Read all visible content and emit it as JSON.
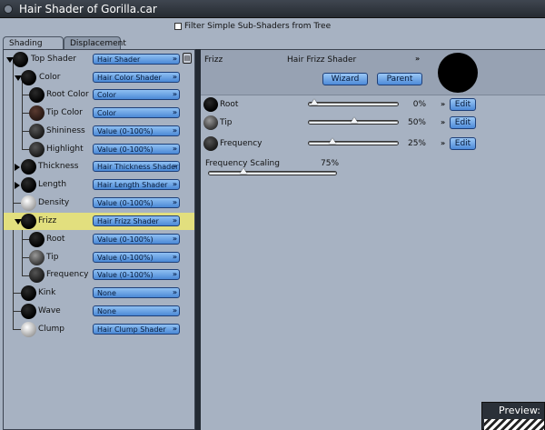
{
  "window": {
    "title": "Hair Shader of Gorilla.car"
  },
  "filter": {
    "label": "Filter Simple Sub-Shaders from Tree",
    "checked": false
  },
  "tabs": [
    {
      "label": "Shading",
      "active": true
    },
    {
      "label": "Displacement",
      "active": false
    }
  ],
  "tree": [
    {
      "label": "Top Shader",
      "value": "Hair Shader",
      "ball": "black"
    },
    {
      "label": "Color",
      "value": "Hair Color Shader",
      "ball": "black"
    },
    {
      "label": "Root Color",
      "value": "Color",
      "ball": "black"
    },
    {
      "label": "Tip Color",
      "value": "Color",
      "ball": "brown"
    },
    {
      "label": "Shininess",
      "value": "Value (0-100%)",
      "ball": "dgrey"
    },
    {
      "label": "Highlight",
      "value": "Value (0-100%)",
      "ball": "dgrey"
    },
    {
      "label": "Thickness",
      "value": "Hair Thickness Shader",
      "ball": "black"
    },
    {
      "label": "Length",
      "value": "Hair Length Shader",
      "ball": "black"
    },
    {
      "label": "Density",
      "value": "Value (0-100%)",
      "ball": "white"
    },
    {
      "label": "Frizz",
      "value": "Hair Frizz Shader",
      "ball": "black",
      "selected": true
    },
    {
      "label": "Root",
      "value": "Value (0-100%)",
      "ball": "black"
    },
    {
      "label": "Tip",
      "value": "Value (0-100%)",
      "ball": "mgrey"
    },
    {
      "label": "Frequency",
      "value": "Value (0-100%)",
      "ball": "dgrey"
    },
    {
      "label": "Kink",
      "value": "None",
      "ball": "black"
    },
    {
      "label": "Wave",
      "value": "None",
      "ball": "black"
    },
    {
      "label": "Clump",
      "value": "Hair Clump Shader",
      "ball": "white"
    }
  ],
  "panel": {
    "name": "Frizz",
    "shader": "Hair Frizz Shader",
    "wizard": "Wizard",
    "parent": "Parent",
    "params": [
      {
        "label": "Root",
        "percent_text": "0%",
        "value": 0,
        "edit": "Edit",
        "ball": "black"
      },
      {
        "label": "Tip",
        "percent_text": "50%",
        "value": 50,
        "edit": "Edit",
        "ball": "mgrey"
      },
      {
        "label": "Frequency",
        "percent_text": "25%",
        "value": 25,
        "edit": "Edit",
        "ball": "dgrey"
      }
    ],
    "scaling": {
      "label": "Frequency Scaling",
      "percent_text": "75%",
      "value": 75
    }
  },
  "preview": {
    "title": "Preview:"
  }
}
